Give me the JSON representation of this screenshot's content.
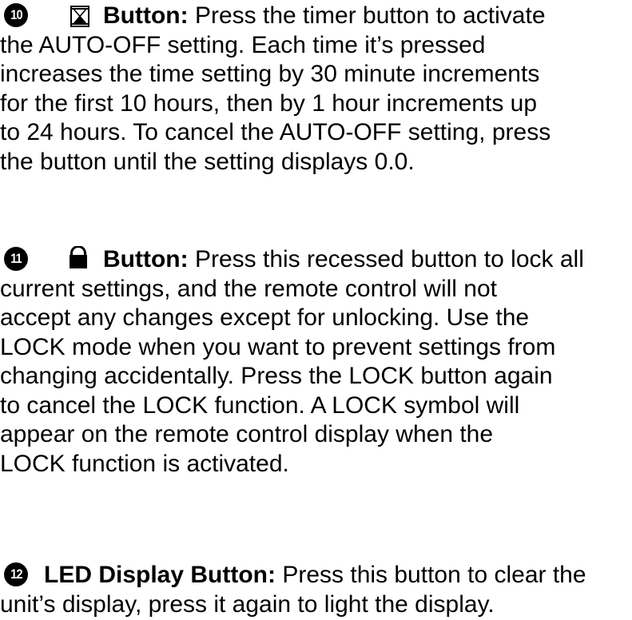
{
  "items": [
    {
      "number": "10",
      "icon": "hourglass-timer-icon",
      "lead": "Button:",
      "first_line_rest": " Press the timer button to activate",
      "lines": [
        "the AUTO-OFF setting. Each time it’s pressed",
        "increases the time setting by 30 minute increments",
        "for the first 10 hours, then by 1 hour increments up",
        "to 24 hours. To cancel the AUTO-OFF setting, press",
        "the button until the setting displays 0.0."
      ]
    },
    {
      "number": "11",
      "icon": "lock-icon",
      "lead": "Button:",
      "first_line_rest": " Press this recessed button to lock all",
      "lines": [
        "current settings, and the remote control will not",
        "accept any changes except for unlocking. Use the",
        "LOCK mode when you want to prevent settings from",
        "changing accidentally. Press the LOCK button again",
        "to cancel the LOCK function. A LOCK symbol will",
        "appear on the remote control display when the",
        "LOCK function is activated."
      ]
    },
    {
      "number": "12",
      "lead": "LED Display Button:",
      "first_line_rest": " Press this button to clear the",
      "lines": [
        "unit’s display, press it again to light the display."
      ]
    }
  ]
}
